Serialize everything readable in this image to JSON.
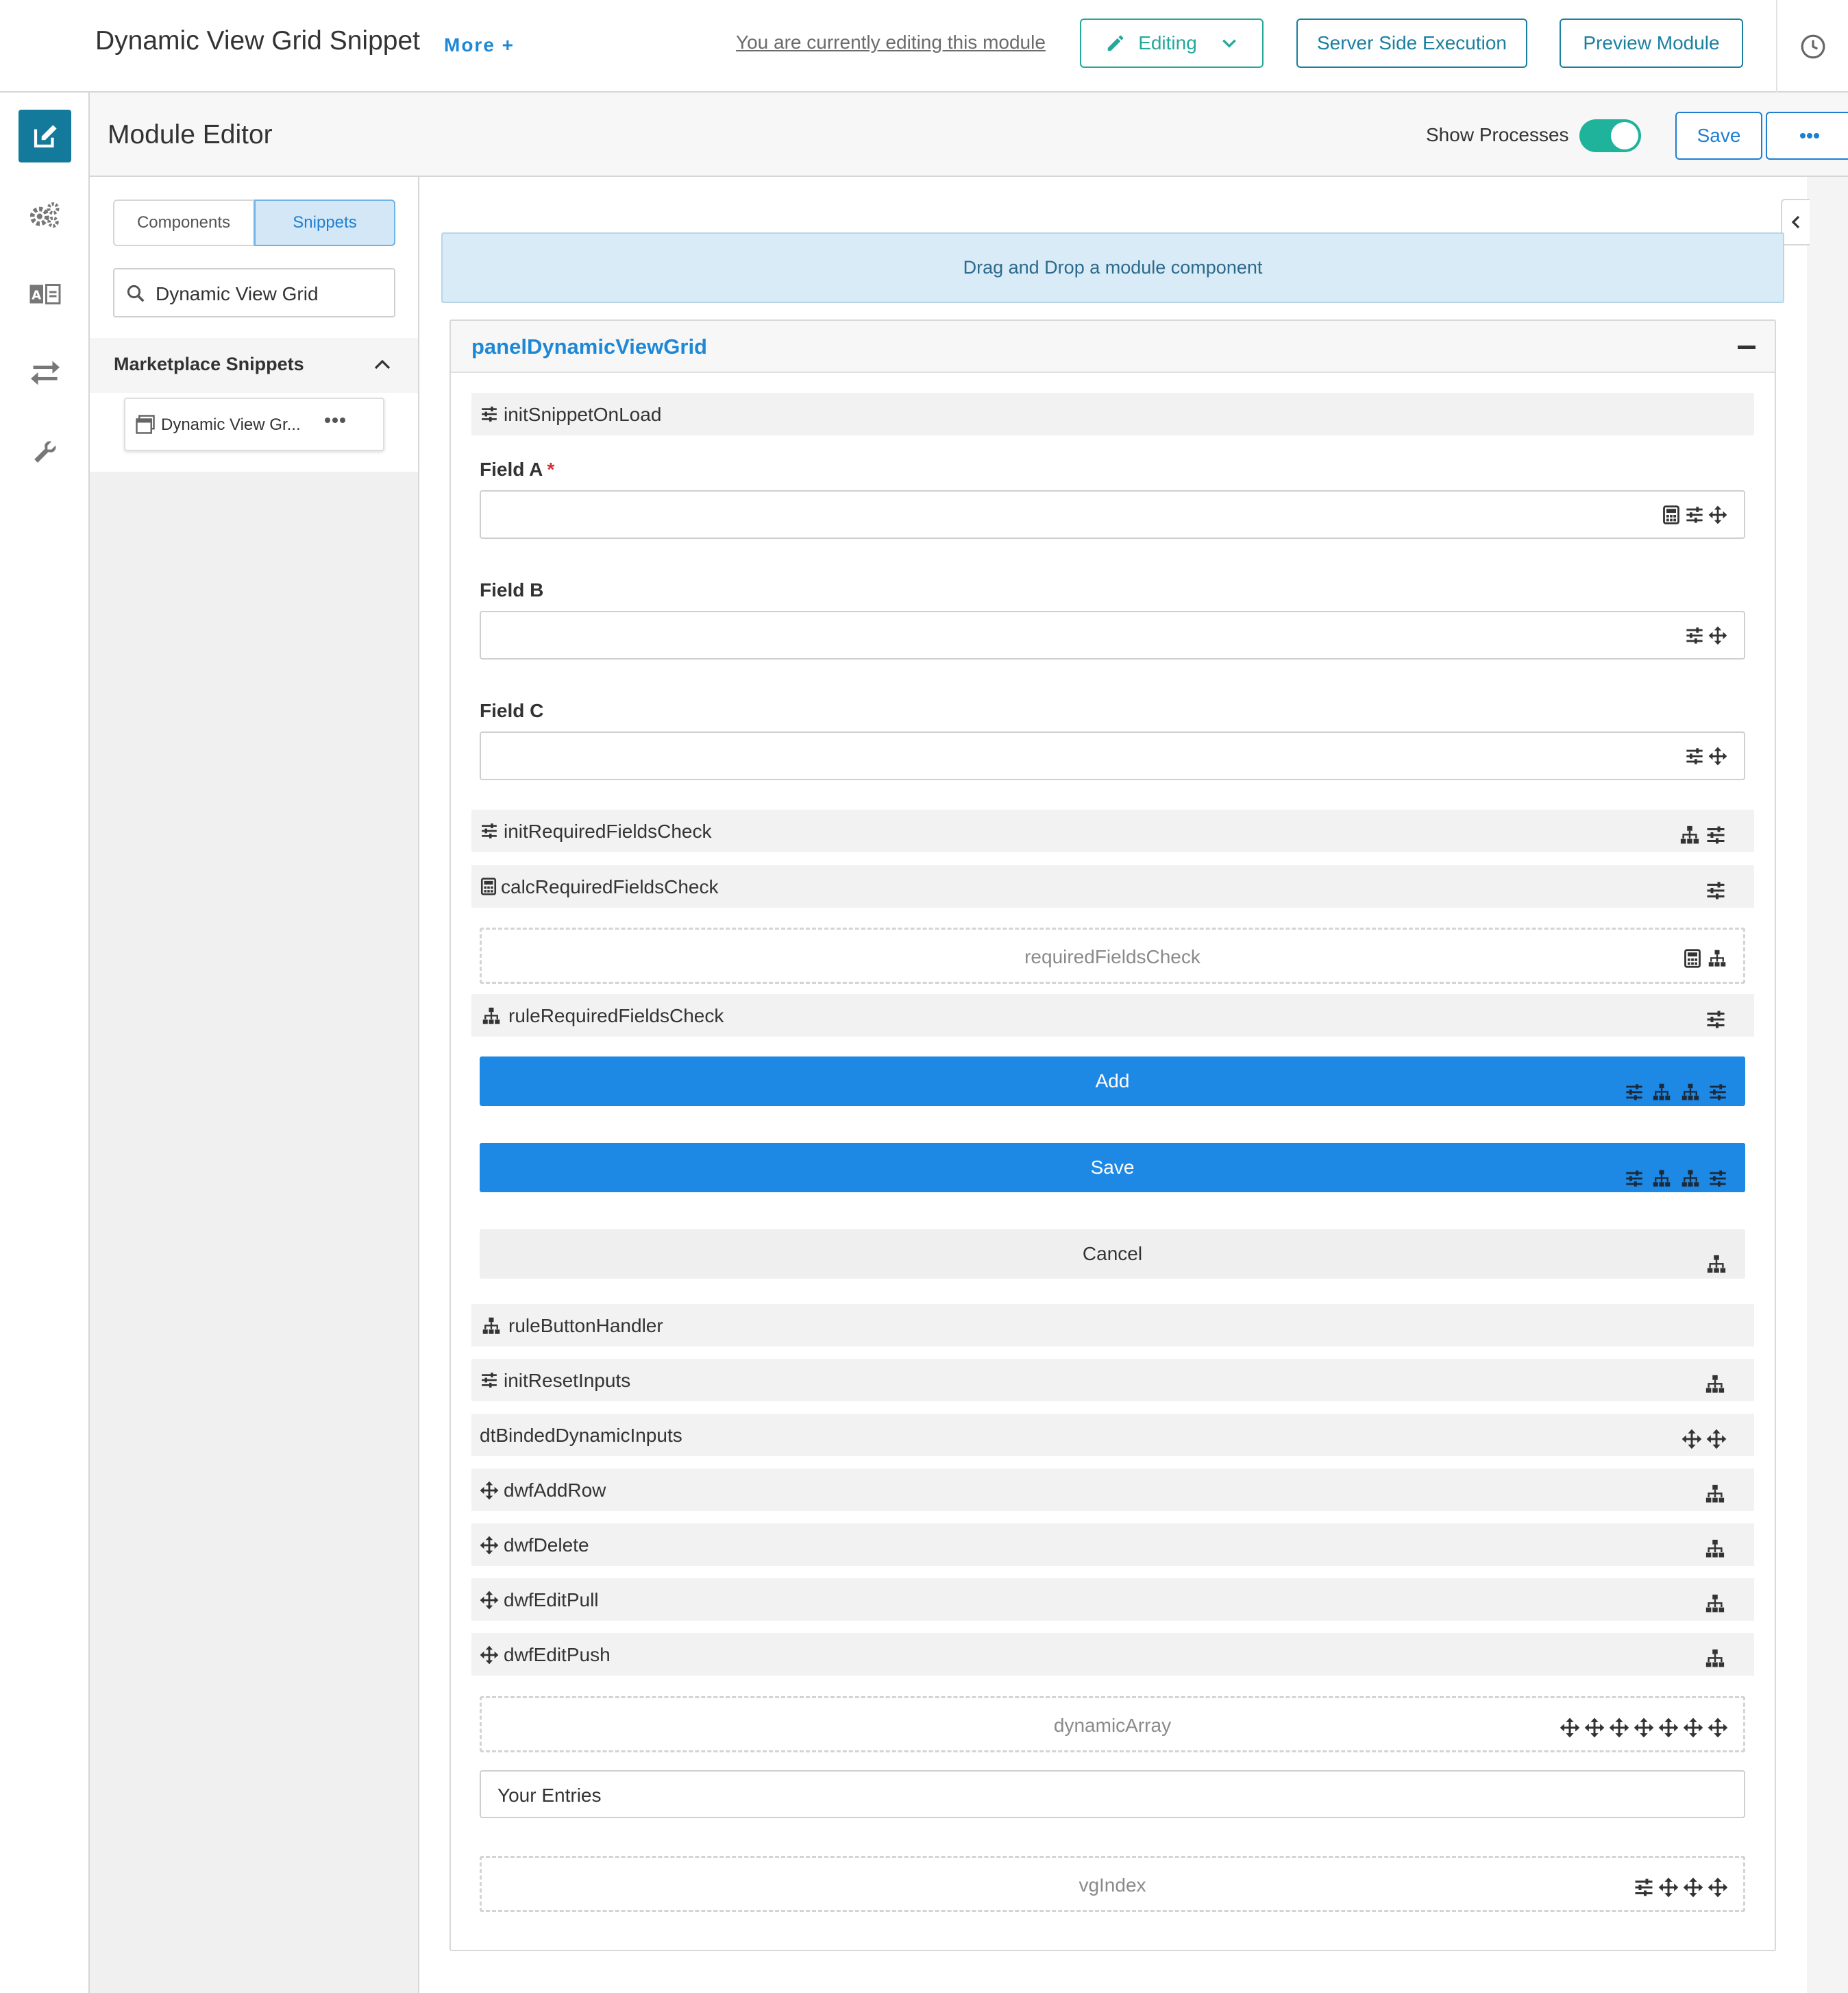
{
  "app": {
    "title": "Dynamic View Grid Snippet",
    "more_label": "More +",
    "editing_note": "You are currently editing this module",
    "editing_label": "Editing",
    "server_label": "Server Side Execution",
    "preview_label": "Preview Module"
  },
  "editor": {
    "title": "Module Editor",
    "show_processes_label": "Show Processes",
    "show_processes_on": true,
    "save_label": "Save"
  },
  "sidebar": {
    "tabs": [
      "Components",
      "Snippets"
    ],
    "active_tab": "Snippets",
    "search_value": "Dynamic View Grid",
    "section_title": "Marketplace Snippets",
    "snippets": [
      {
        "label": "Dynamic View Gr..."
      }
    ]
  },
  "canvas": {
    "dropzone_text": "Drag and Drop a module component",
    "panel_title": "panelDynamicViewGrid",
    "init_snippet": "initSnippetOnLoad",
    "field_a_label": "Field A",
    "field_a_required": "*",
    "field_b_label": "Field B",
    "field_c_label": "Field C",
    "init_required": "initRequiredFieldsCheck",
    "calc_required": "calcRequiredFieldsCheck",
    "required_check": "requiredFieldsCheck",
    "rule_required": "ruleRequiredFieldsCheck",
    "add_label": "Add",
    "save_label": "Save",
    "cancel_label": "Cancel",
    "rule_button": "ruleButtonHandler",
    "init_reset": "initResetInputs",
    "dt_binded": "dtBindedDynamicInputs",
    "dwf_add": "dwfAddRow",
    "dwf_delete": "dwfDelete",
    "dwf_edit_pull": "dwfEditPull",
    "dwf_edit_push": "dwfEditPush",
    "dynamic_array": "dynamicArray",
    "entries_label": "Your Entries",
    "vg_index": "vgIndex"
  },
  "colors": {
    "accent": "#1e88e5",
    "teal": "#137a9c",
    "toggle": "#1fb39c",
    "required": "#d32f2f"
  },
  "icons": [
    "edit-icon",
    "gears-icon",
    "translate-icon",
    "exchange-icon",
    "wrench-icon",
    "history-icon",
    "search-icon",
    "chevron-up-icon",
    "window-icon",
    "ellipsis-icon",
    "sliders-icon",
    "calculator-icon",
    "sitemap-icon",
    "move-icon",
    "pencil-icon",
    "chevron-down-icon",
    "chevron-left-icon"
  ]
}
